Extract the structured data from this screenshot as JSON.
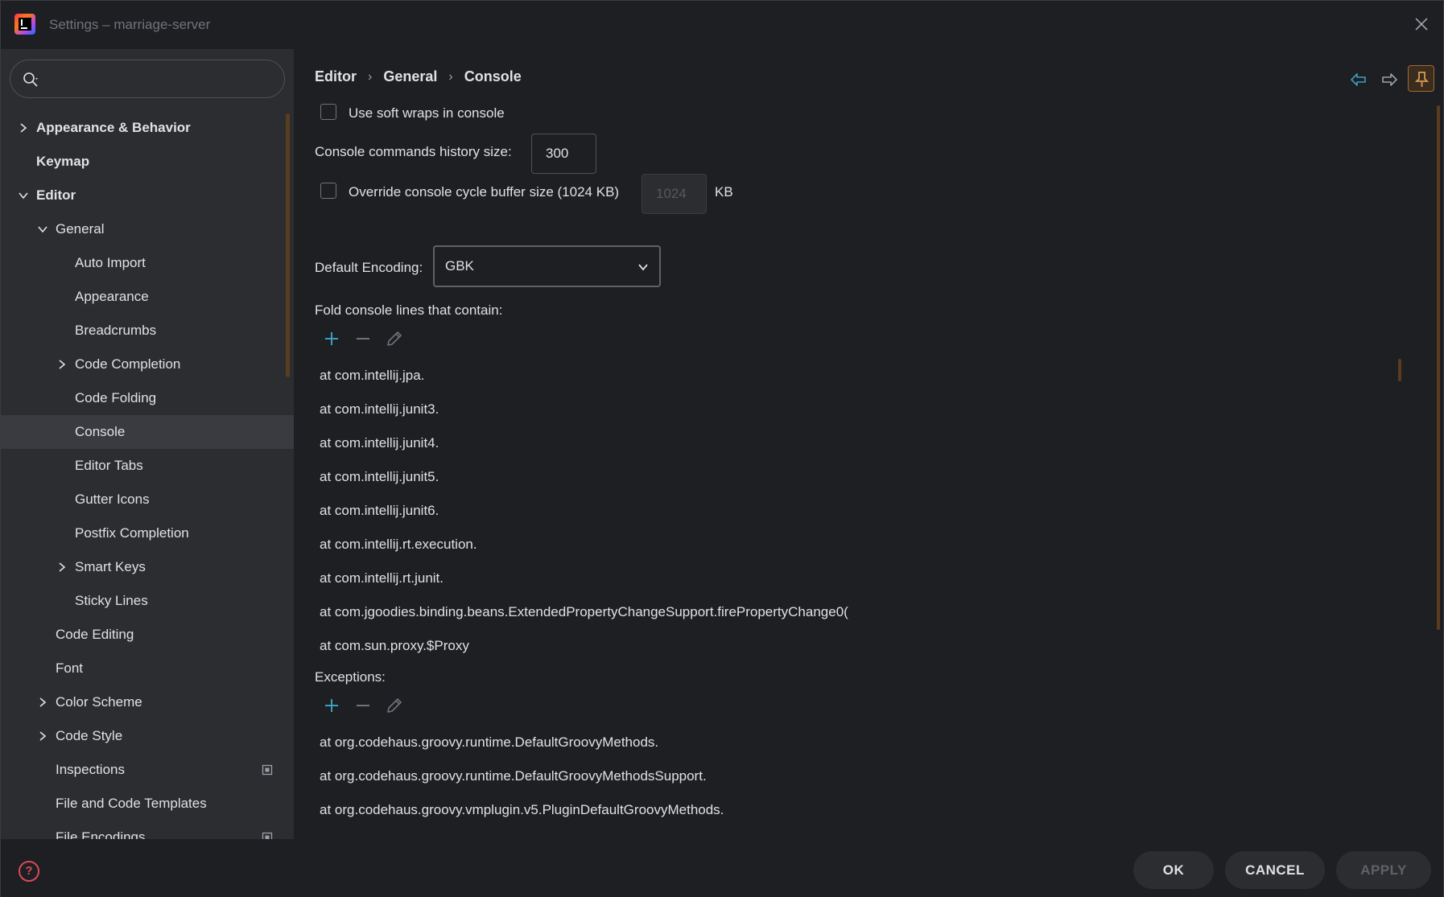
{
  "window": {
    "title": "Settings – marriage-server"
  },
  "search": {
    "value": "",
    "placeholder": ""
  },
  "tree": [
    {
      "label": "Appearance & Behavior",
      "expanded": false
    },
    {
      "label": "Keymap"
    },
    {
      "label": "Editor",
      "expanded": true
    },
    {
      "label": "General",
      "expanded": true
    },
    {
      "label": "Auto Import"
    },
    {
      "label": "Appearance"
    },
    {
      "label": "Breadcrumbs"
    },
    {
      "label": "Code Completion",
      "expanded": false
    },
    {
      "label": "Code Folding"
    },
    {
      "label": "Console",
      "selected": true
    },
    {
      "label": "Editor Tabs"
    },
    {
      "label": "Gutter Icons"
    },
    {
      "label": "Postfix Completion"
    },
    {
      "label": "Smart Keys",
      "expanded": false
    },
    {
      "label": "Sticky Lines"
    },
    {
      "label": "Code Editing"
    },
    {
      "label": "Font"
    },
    {
      "label": "Color Scheme",
      "expanded": false
    },
    {
      "label": "Code Style",
      "expanded": false
    },
    {
      "label": "Inspections",
      "badge": "settings-badge-icon"
    },
    {
      "label": "File and Code Templates"
    },
    {
      "label": "File Encodings",
      "badge": "settings-badge-icon"
    }
  ],
  "breadcrumb": {
    "level1": "Editor",
    "level2": "General",
    "level3": "Console"
  },
  "console": {
    "soft_wraps_label": "Use soft wraps in console",
    "history_label": "Console commands history size:",
    "history_value": "300",
    "override_label": "Override console cycle buffer size (1024 KB)",
    "override_value": "1024",
    "override_unit": "KB",
    "encoding_label": "Default Encoding:",
    "encoding_value": "GBK",
    "fold_label": "Fold console lines that contain:",
    "fold_items": [
      "at com.intellij.jpa.",
      "at com.intellij.junit3.",
      "at com.intellij.junit4.",
      "at com.intellij.junit5.",
      "at com.intellij.junit6.",
      "at com.intellij.rt.execution.",
      "at com.intellij.rt.junit.",
      "at com.jgoodies.binding.beans.ExtendedPropertyChangeSupport.firePropertyChange0(",
      "at com.sun.proxy.$Proxy"
    ],
    "exceptions_label": "Exceptions:",
    "exception_items": [
      "at org.codehaus.groovy.runtime.DefaultGroovyMethods.",
      "at org.codehaus.groovy.runtime.DefaultGroovyMethodsSupport.",
      "at org.codehaus.groovy.vmplugin.v5.PluginDefaultGroovyMethods."
    ]
  },
  "footer": {
    "help": "?",
    "ok": "OK",
    "cancel": "CANCEL",
    "apply": "APPLY"
  },
  "colors": {
    "accent": "#3d9fbf",
    "pin_border": "#a0692f",
    "help": "#d84a5b"
  }
}
